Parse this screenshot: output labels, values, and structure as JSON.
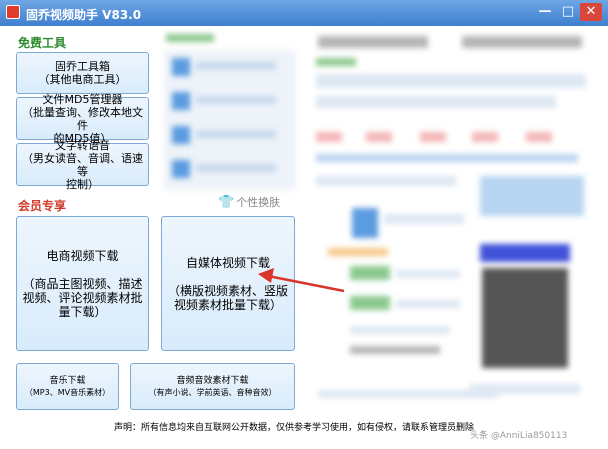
{
  "window": {
    "title": "固乔视频助手  V83.0",
    "minimize_glyph": "—",
    "maximize_glyph": "□",
    "close_glyph": "✕"
  },
  "free_tools": {
    "label": "免费工具",
    "buttons": [
      {
        "lines": [
          "固乔工具箱",
          "（其他电商工具）"
        ]
      },
      {
        "lines": [
          "文件MD5管理器",
          "（批量查询、修改本地文件",
          "的MD5值）"
        ]
      },
      {
        "lines": [
          "文字转语音",
          "（男女读音、音调、语速等",
          "控制）"
        ]
      }
    ]
  },
  "member": {
    "label": "会员专享",
    "ecom_video": {
      "lines": [
        "电商视频下载",
        "",
        "（商品主图视频、描述",
        "视频、评论视频素材批",
        "量下载）"
      ]
    },
    "media_video": {
      "lines": [
        "自媒体视频下载",
        "",
        "（横版视频素材、竖版",
        "视频素材批量下载）"
      ]
    },
    "music": {
      "lines": [
        "音乐下载",
        "（MP3、MV音乐素材）"
      ]
    },
    "audio": {
      "lines": [
        "音频音效素材下载",
        "（有声小说、学前英语、音种音效）"
      ]
    }
  },
  "skin": {
    "icon": "shirt-icon",
    "glyph": "👕",
    "label": "个性换肤"
  },
  "footer": {
    "declaration": "声明：所有信息均来自互联网公开数据，仅供参考学习使用，如有侵权，请联系管理员删除",
    "watermark": "头条 @AnniLia850113"
  },
  "colors": {
    "titlebar": "#3f7fcf",
    "free_label": "#2e8b2e",
    "member_label": "#d23b2a",
    "arrow": "#d9352a"
  }
}
